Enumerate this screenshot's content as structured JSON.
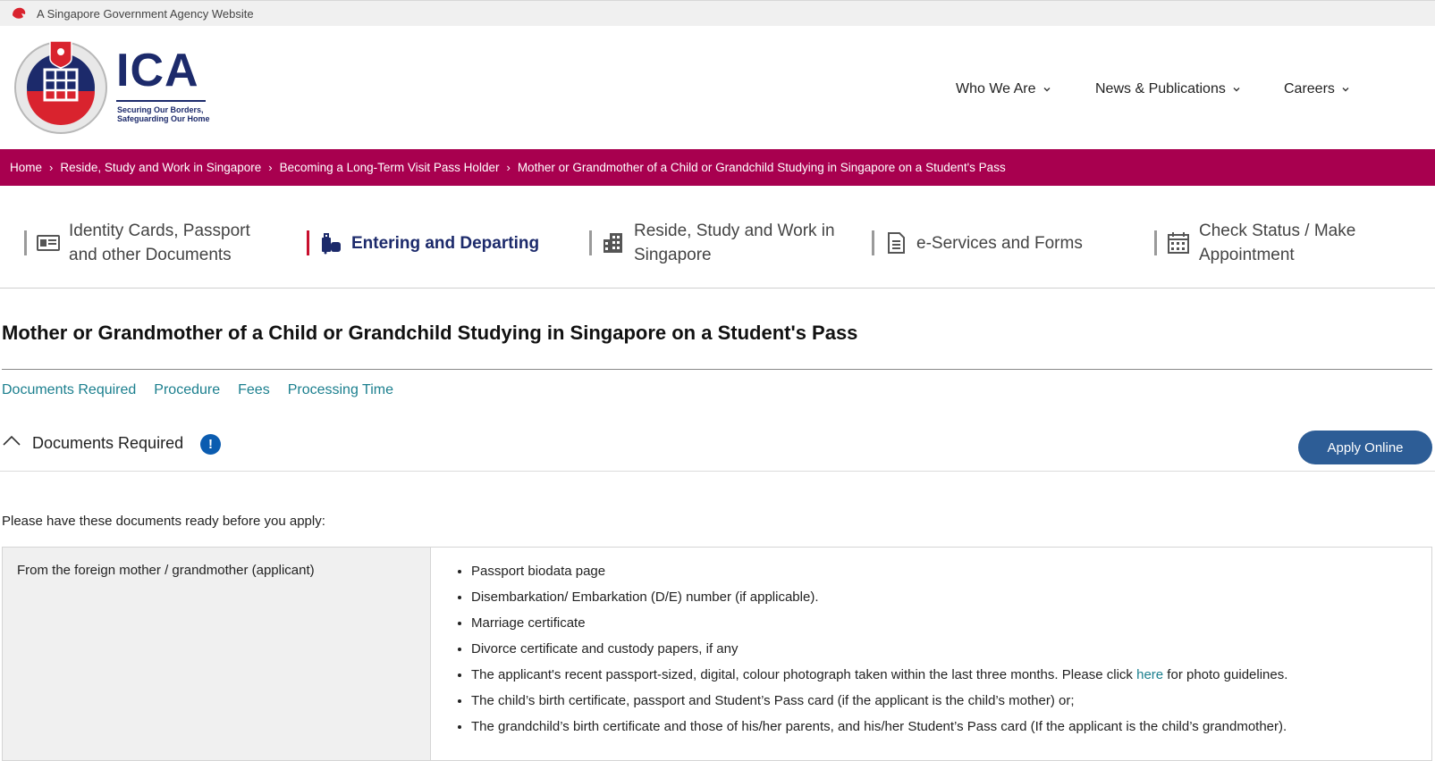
{
  "masthead": {
    "text": "A Singapore Government Agency Website",
    "icon": "lion-head-icon"
  },
  "header": {
    "logo_word": "ICA",
    "logo_tagline_1": "Securing Our Borders,",
    "logo_tagline_2": "Safeguarding Our Home",
    "nav": [
      {
        "label": "Who We Are"
      },
      {
        "label": "News & Publications"
      },
      {
        "label": "Careers"
      }
    ]
  },
  "breadcrumb": [
    "Home",
    "Reside, Study and Work in Singapore",
    "Becoming a Long-Term Visit Pass Holder",
    "Mother or Grandmother of a Child or Grandchild Studying in Singapore on a Student's Pass"
  ],
  "categories": [
    {
      "label": "Identity Cards, Passport and other Documents",
      "icon": "id-card-icon"
    },
    {
      "label": "Entering and Departing",
      "icon": "luggage-icon",
      "active": true
    },
    {
      "label": "Reside, Study and Work in Singapore",
      "icon": "building-icon"
    },
    {
      "label": "e-Services and Forms",
      "icon": "document-icon"
    },
    {
      "label": "Check Status / Make Appointment",
      "icon": "calendar-icon"
    }
  ],
  "page": {
    "title": "Mother or Grandmother of a Child or Grandchild Studying in Singapore on a Student's Pass",
    "anchors": [
      "Documents Required",
      "Procedure",
      "Fees",
      "Processing Time"
    ]
  },
  "section": {
    "title": "Documents Required",
    "info_symbol": "!",
    "apply_label": "Apply Online",
    "intro": "Please have these documents ready before you apply:"
  },
  "documents": {
    "left_label": "From the foreign mother / grandmother (applicant)",
    "items": [
      "Passport biodata page",
      "Disembarkation/ Embarkation (D/E) number (if applicable).",
      "Marriage certificate",
      "Divorce certificate and custody papers, if any"
    ],
    "photo_item_before": "The applicant's recent passport-sized, digital, colour photograph taken within the last three months. Please click ",
    "photo_item_link": "here",
    "photo_item_after": " for photo guidelines.",
    "items_after": [
      "The child’s birth certificate, passport and Student’s Pass card (if the applicant is the child’s mother) or;",
      "The grandchild’s birth certificate and those of his/her parents, and his/her Student’s Pass card (If the applicant is the child’s grandmother)."
    ]
  },
  "colors": {
    "brand_maroon": "#a8004f",
    "brand_navy": "#1c2a6b",
    "link_teal": "#1b7f8e",
    "button_blue": "#2d5d96"
  }
}
